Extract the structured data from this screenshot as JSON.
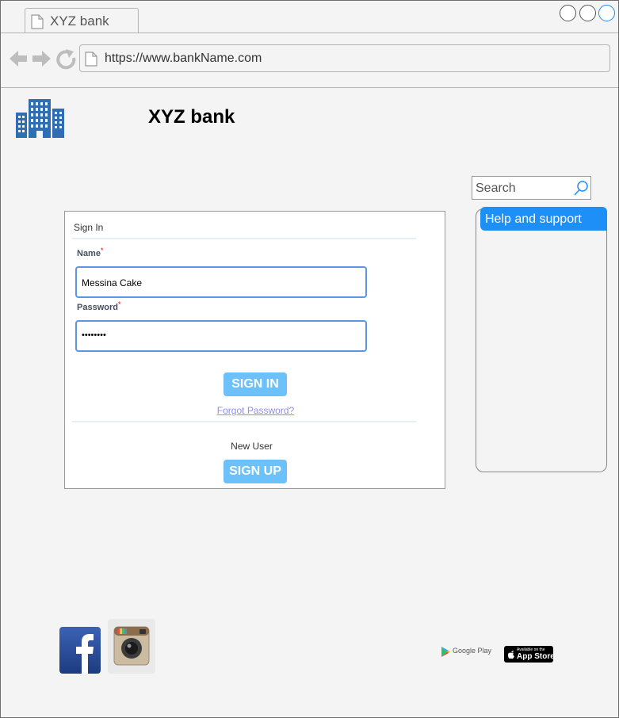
{
  "browser": {
    "tab_title": "XYZ bank",
    "url": "https://www.bankName.com"
  },
  "header": {
    "brand_name": "XYZ bank",
    "logo_icon": "building-icon",
    "accent_color": "#2f6eb5"
  },
  "search": {
    "placeholder": "Search"
  },
  "help": {
    "title": "Help and support",
    "color": "#1e8ff7"
  },
  "signin": {
    "title": "Sign In",
    "name_label": "Name",
    "name_value": "Messina Cake",
    "password_label": "Password",
    "password_value": "••••••••",
    "required_mark": "*",
    "signin_button": "SIGN IN",
    "forgot_link": "Forgot Password?",
    "new_user_text": "New User",
    "signup_button": "SIGN UP",
    "button_color": "#6cc1fb"
  },
  "footer": {
    "social_icons": [
      "facebook-icon",
      "instagram-icon"
    ],
    "google_play_label": "Google Play",
    "app_store_small": "Available on the",
    "app_store_big": "App Store"
  }
}
